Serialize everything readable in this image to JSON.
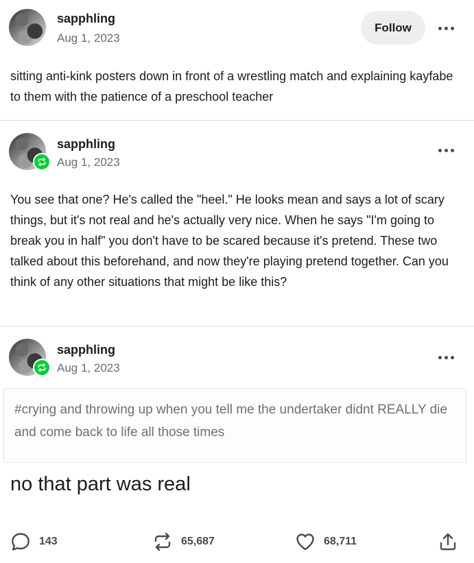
{
  "posts": [
    {
      "username": "sapphling",
      "date": "Aug 1, 2023",
      "follow_label": "Follow",
      "text": "sitting anti-kink posters down in front of a wrestling match and explaining kayfabe to them with the patience of a preschool teacher"
    },
    {
      "username": "sapphling",
      "date": "Aug 1, 2023",
      "text": "You see that one? He's called the \"heel.\" He looks mean and says a lot of scary things, but it's not real and he's actually very nice. When he says \"I'm going to break you in half\" you don't have to be scared because it's pretend. These two talked about this beforehand, and now they're playing pretend together. Can you think of any other situations that might be like this?"
    },
    {
      "username": "sapphling",
      "date": "Aug 1, 2023",
      "tag_quote": "#crying and throwing up when you tell me the undertaker didnt REALLY die and come back to life all those times",
      "big_text": "no that part was real"
    }
  ],
  "actions": {
    "replies": "143",
    "reblogs": "65,687",
    "likes": "68,711"
  },
  "icons": {
    "reply": "speech-bubble-icon",
    "reblog": "reblog-arrows-icon",
    "like": "heart-icon",
    "share": "share-upload-icon",
    "more": "ellipsis-icon"
  },
  "colors": {
    "reblog_green": "#00cf35",
    "follow_bg": "#eeeeee"
  }
}
